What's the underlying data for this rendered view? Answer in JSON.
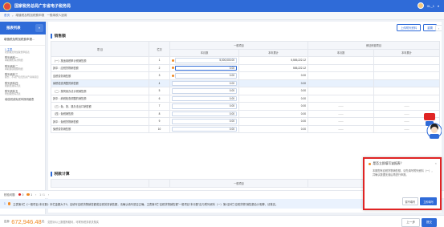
{
  "app": {
    "title": "国家税务总局广东省电子税务局",
    "user": "XL_1",
    "breadcrumb": [
      "首页",
      "增值税及附加税费申报",
      "一般纳税人适用"
    ]
  },
  "sidebar": {
    "title": "报表列表",
    "collapse_label": "«",
    "form_name": "增值税及附加税费申报…",
    "items": [
      {
        "label": "1 主表",
        "sub": "增值税及附加税费申报表",
        "active": true
      },
      {
        "label": "附列资料一",
        "sub": "本期销售情况明细"
      },
      {
        "label": "附列资料二",
        "sub": "本期进项税额明细"
      },
      {
        "label": "附列资料三",
        "sub": "服务、不动产和无形资产扣除项目"
      },
      {
        "label": "附列资料四",
        "sub": "税额抵减情况表"
      },
      {
        "label": "附列资料五",
        "sub": "附加税费情况表"
      },
      {
        "label": "增值税减免税申报明细表",
        "sub": ""
      }
    ]
  },
  "toolbar": {
    "btn1": "上传附列资料",
    "btn2": "重置"
  },
  "sections": {
    "sales": "销售额",
    "tax": "税款计算"
  },
  "table": {
    "headers": {
      "item": "项 目",
      "line": "栏次",
      "general": "一般项目",
      "immediate": "即征即退项目",
      "month": "本月数",
      "year": "本年累计"
    },
    "rows": [
      {
        "label": "（一）按适用税率计税销售额",
        "line": "1",
        "m1": "5,000,000.00",
        "y1": "5,555,222.12",
        "m2": "",
        "y2": "",
        "warn": true
      },
      {
        "label": "其中：应税货物销售额",
        "line": "2",
        "m1": "0.00",
        "y1": "555,222.12",
        "m2": "",
        "y2": "",
        "warn": true,
        "focus": true
      },
      {
        "label": "应税劳务销售额",
        "line": "3",
        "m1": "0.00",
        "y1": "0.00",
        "m2": "",
        "y2": "",
        "warn": true
      },
      {
        "label": "纳税检查调整的销售额",
        "line": "4",
        "m1": "0.00",
        "y1": "0.00",
        "m2": "",
        "y2": "",
        "hl": true
      },
      {
        "label": "（二）按简易办法计税销售额",
        "line": "5",
        "m1": "0.00",
        "y1": "0.00",
        "m2": "",
        "y2": ""
      },
      {
        "label": "其中：纳税检查调整的销售额",
        "line": "6",
        "m1": "0.00",
        "y1": "0.00",
        "m2": "",
        "y2": ""
      },
      {
        "label": "（三）免、抵、退办法出口销售额",
        "line": "7",
        "m1": "0.00",
        "y1": "0.00",
        "m2": "——",
        "y2": "——"
      },
      {
        "label": "（四）免税销售额",
        "line": "8",
        "m1": "0.00",
        "y1": "0.00",
        "m2": "——",
        "y2": "——"
      },
      {
        "label": "其中：免税货物销售额",
        "line": "9",
        "m1": "0.00",
        "y1": "0.00",
        "m2": "——",
        "y2": "——"
      },
      {
        "label": "免税劳务销售额",
        "line": "10",
        "m1": "0.00",
        "y1": "0.00",
        "m2": "——",
        "y2": "——"
      }
    ],
    "tax_header": "一般项目"
  },
  "status": {
    "label": "校验问题",
    "errors": "0",
    "warnings": "1",
    "page": "1 / 1"
  },
  "message": {
    "index": "1",
    "text": "主表第1栏《一般项目-本月数》本栏金额大于0，应填写应税货物销售额或应税劳务销售额，请确认填写是否正确。主表第2栏“应税货物销售额”一般项目“本月数”应与附列资料（一）第1至5栏“应税货物”销售额合计相等，请核实。"
  },
  "bottom": {
    "total_label": "应补",
    "total_value": "672,946.48",
    "total_unit": "元",
    "note": "如您对以上数据有疑问，可联系税务机关核实",
    "prev": "上一步",
    "submit": "提交"
  },
  "popup": {
    "title": "是否立即填写该报表？",
    "body": "本期您有应税货物销售额，请先填写附列资料（一），并确认数据无误后再进行申报。",
    "cancel": "暂不填写",
    "confirm": "立即填写"
  },
  "colors": {
    "primary": "#2f6bd8",
    "warning": "#f08a24",
    "error": "#e02424"
  }
}
